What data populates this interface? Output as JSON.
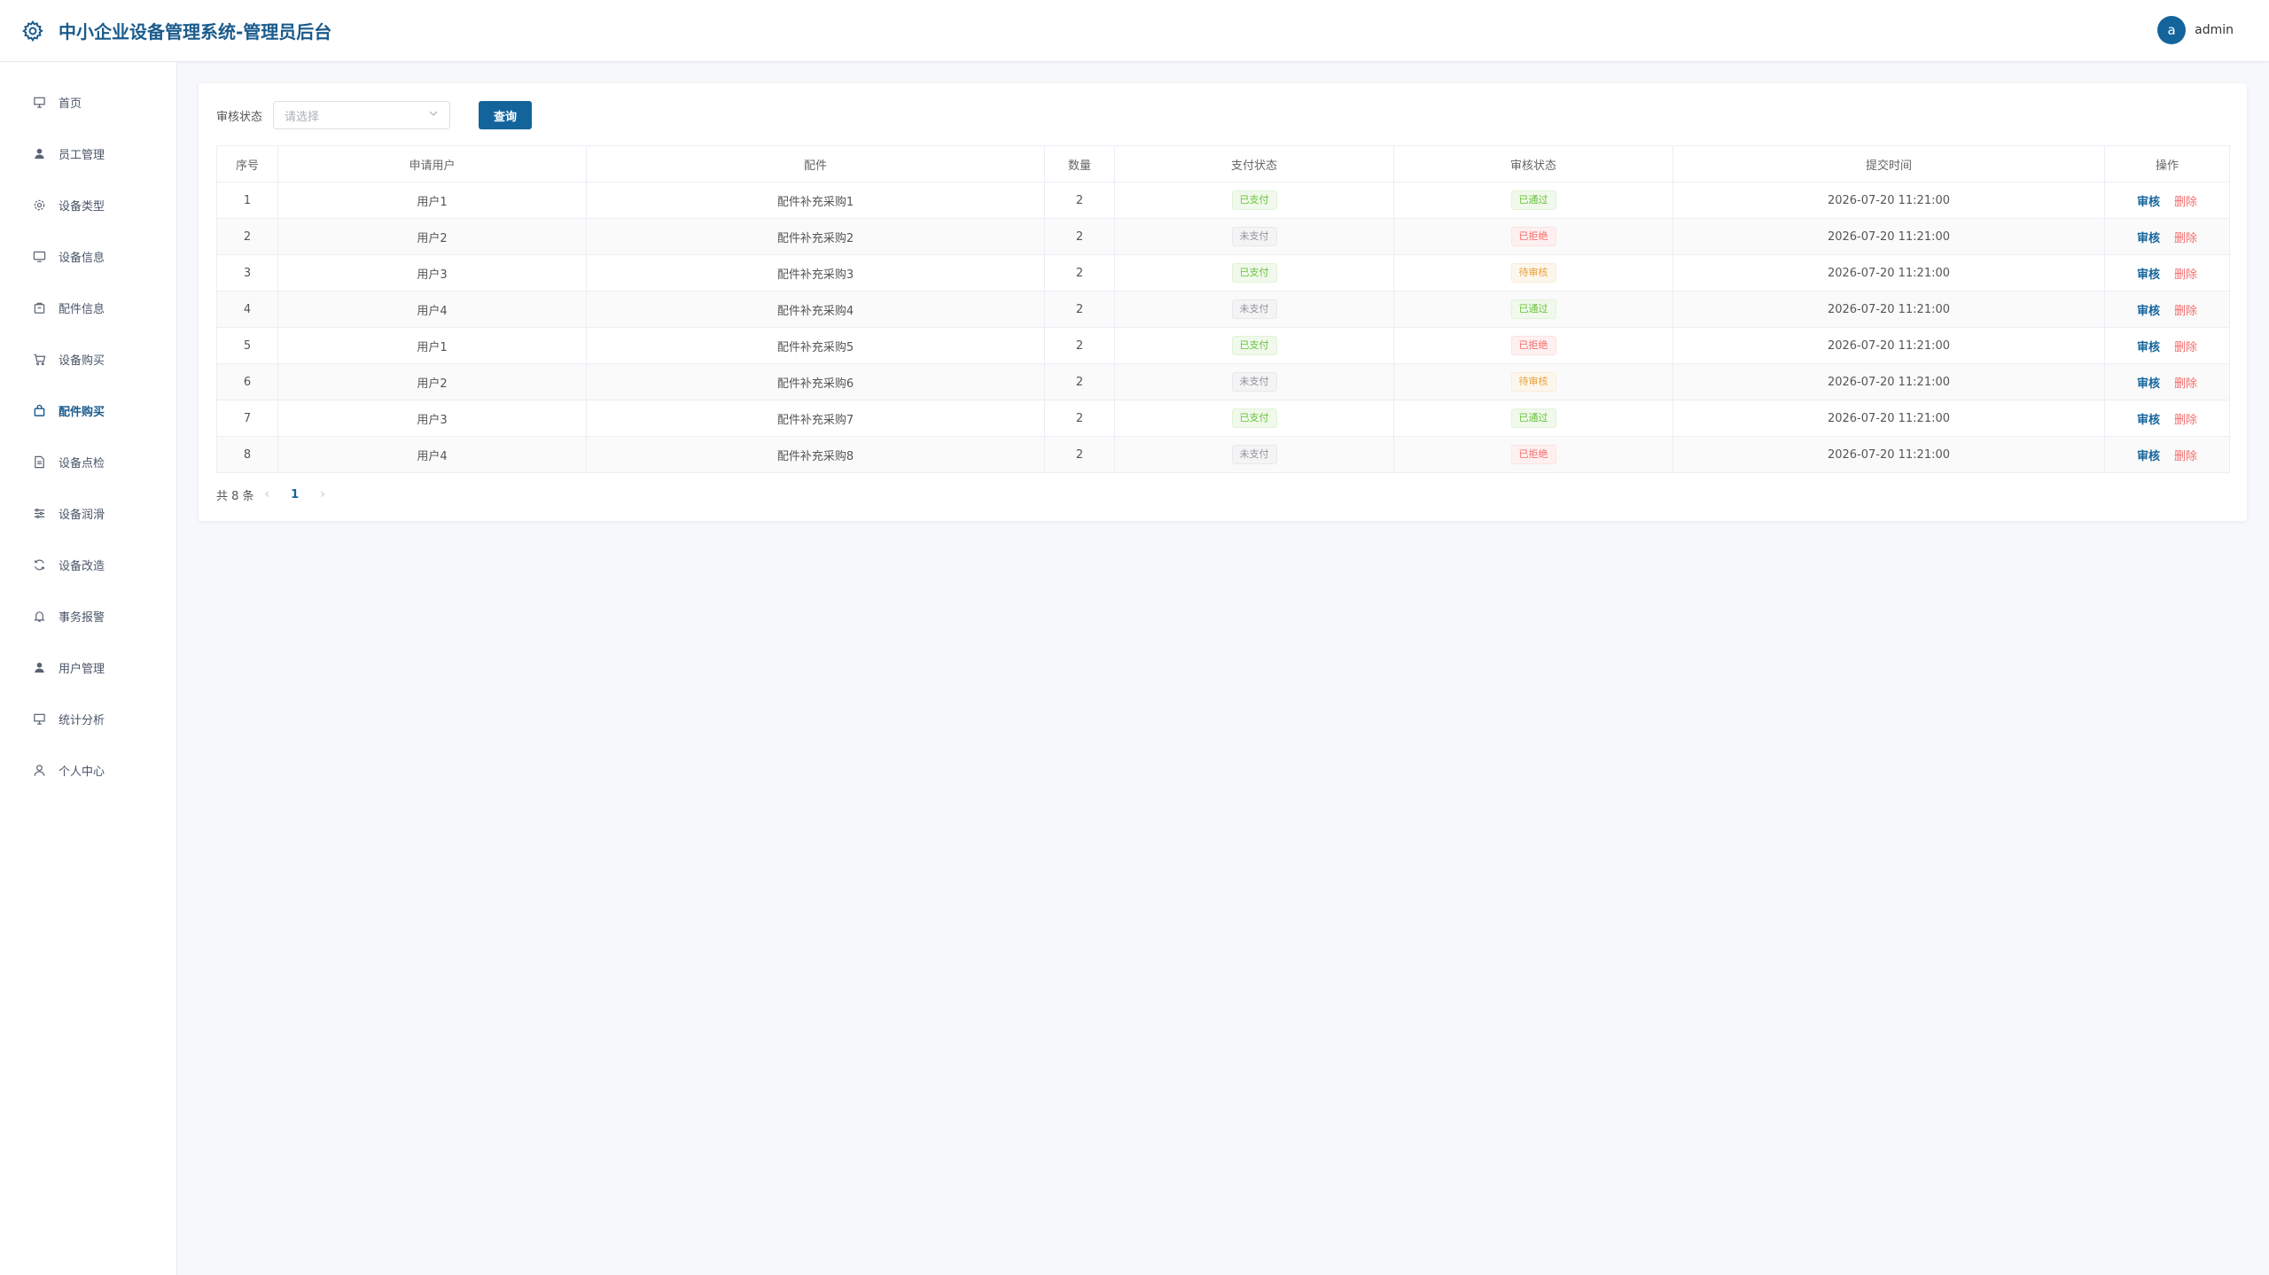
{
  "header": {
    "title": "中小企业设备管理系统-管理员后台",
    "avatar_letter": "a",
    "username": "admin"
  },
  "sidebar": {
    "items": [
      {
        "label": "首页",
        "icon": "presentation-icon"
      },
      {
        "label": "员工管理",
        "icon": "person-icon"
      },
      {
        "label": "设备类型",
        "icon": "gear-icon"
      },
      {
        "label": "设备信息",
        "icon": "monitor-icon"
      },
      {
        "label": "配件信息",
        "icon": "box-icon"
      },
      {
        "label": "设备购买",
        "icon": "cart-icon"
      },
      {
        "label": "配件购买",
        "icon": "bag-icon"
      },
      {
        "label": "设备点检",
        "icon": "document-icon"
      },
      {
        "label": "设备润滑",
        "icon": "sliders-icon"
      },
      {
        "label": "设备改造",
        "icon": "refresh-icon"
      },
      {
        "label": "事务报警",
        "icon": "bell-icon"
      },
      {
        "label": "用户管理",
        "icon": "person-icon"
      },
      {
        "label": "统计分析",
        "icon": "presentation-icon"
      },
      {
        "label": "个人中心",
        "icon": "user-outline-icon"
      }
    ],
    "active_index": 6
  },
  "filter": {
    "label": "审核状态",
    "placeholder": "请选择",
    "query_label": "查询"
  },
  "table": {
    "headers": [
      "序号",
      "申请用户",
      "配件",
      "数量",
      "支付状态",
      "审核状态",
      "提交时间",
      "操作"
    ],
    "rows": [
      {
        "no": "1",
        "user": "用户1",
        "part": "配件补充采购1",
        "qty": "2",
        "pay": "已支付",
        "pay_type": "paid",
        "audit": "已通过",
        "audit_type": "approved",
        "time": "2026-07-20 11:21:00"
      },
      {
        "no": "2",
        "user": "用户2",
        "part": "配件补充采购2",
        "qty": "2",
        "pay": "未支付",
        "pay_type": "unpaid",
        "audit": "已拒绝",
        "audit_type": "rejected",
        "time": "2026-07-20 11:21:00"
      },
      {
        "no": "3",
        "user": "用户3",
        "part": "配件补充采购3",
        "qty": "2",
        "pay": "已支付",
        "pay_type": "paid",
        "audit": "待审核",
        "audit_type": "pending",
        "time": "2026-07-20 11:21:00"
      },
      {
        "no": "4",
        "user": "用户4",
        "part": "配件补充采购4",
        "qty": "2",
        "pay": "未支付",
        "pay_type": "unpaid",
        "audit": "已通过",
        "audit_type": "approved",
        "time": "2026-07-20 11:21:00"
      },
      {
        "no": "5",
        "user": "用户1",
        "part": "配件补充采购5",
        "qty": "2",
        "pay": "已支付",
        "pay_type": "paid",
        "audit": "已拒绝",
        "audit_type": "rejected",
        "time": "2026-07-20 11:21:00"
      },
      {
        "no": "6",
        "user": "用户2",
        "part": "配件补充采购6",
        "qty": "2",
        "pay": "未支付",
        "pay_type": "unpaid",
        "audit": "待审核",
        "audit_type": "pending",
        "time": "2026-07-20 11:21:00"
      },
      {
        "no": "7",
        "user": "用户3",
        "part": "配件补充采购7",
        "qty": "2",
        "pay": "已支付",
        "pay_type": "paid",
        "audit": "已通过",
        "audit_type": "approved",
        "time": "2026-07-20 11:21:00"
      },
      {
        "no": "8",
        "user": "用户4",
        "part": "配件补充采购8",
        "qty": "2",
        "pay": "未支付",
        "pay_type": "unpaid",
        "audit": "已拒绝",
        "audit_type": "rejected",
        "time": "2026-07-20 11:21:00"
      }
    ],
    "actions": {
      "audit": "审核",
      "delete": "删除"
    }
  },
  "pagination": {
    "total_text": "共 8 条",
    "current_page": "1"
  },
  "colors": {
    "primary": "#14649c",
    "success": "#67c23a",
    "danger": "#f56c6c",
    "warning": "#e6a23c",
    "info": "#909399"
  }
}
